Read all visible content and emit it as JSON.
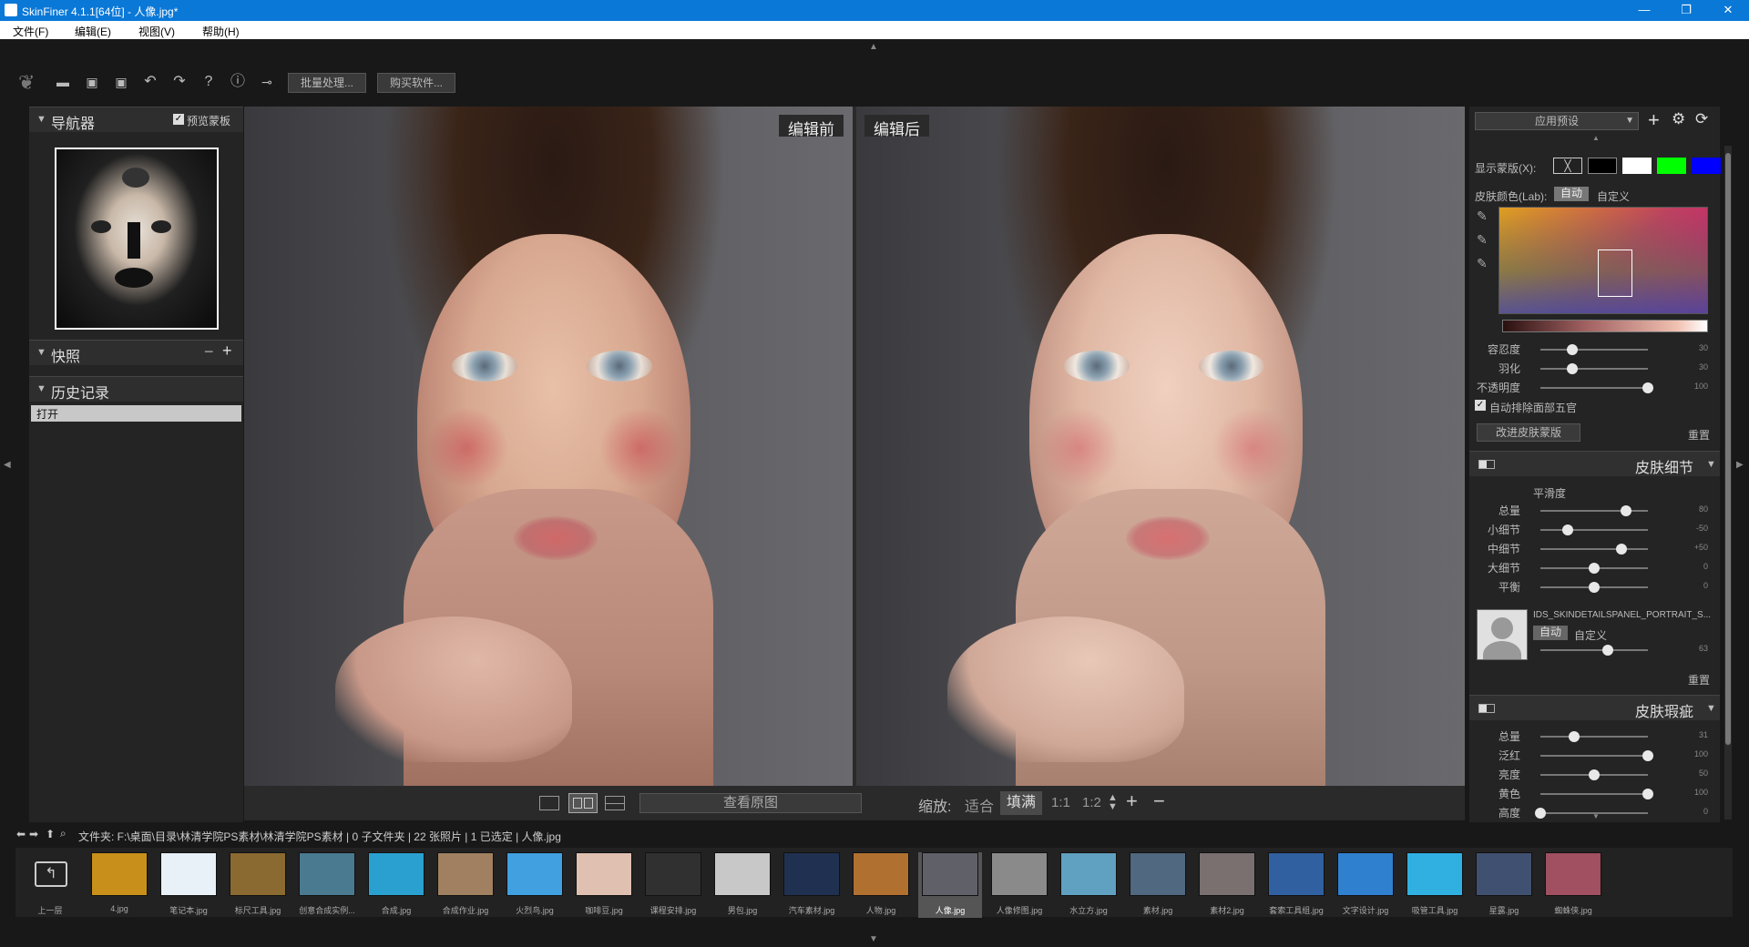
{
  "window": {
    "title": "SkinFiner 4.1.1[64位] - 人像.jpg*",
    "minimize": "—",
    "maximize": "❐",
    "close": "✕"
  },
  "menu": [
    "文件(F)",
    "编辑(E)",
    "视图(V)",
    "帮助(H)"
  ],
  "toolbar": {
    "batch_label": "批量处理...",
    "buy_label": "购买软件...",
    "help_glyph": "?",
    "info_glyph": "ⓘ"
  },
  "navigator": {
    "title": "导航器",
    "preview_mask_label": "预览蒙板",
    "preview_mask_checked": true
  },
  "snapshots": {
    "title": "快照"
  },
  "history": {
    "title": "历史记录",
    "items": [
      "打开"
    ]
  },
  "view": {
    "before_label": "编辑前",
    "after_label": "编辑后",
    "view_original_label": "查看原图",
    "zoom_label": "缩放:",
    "fit_label": "适合",
    "fill_label": "填满",
    "one_to_one": "1:1",
    "one_to_two": "1:2"
  },
  "right_panel": {
    "preset_label": "应用预设",
    "show_mask_label": "显示蒙版(X):",
    "mask_colors": [
      "#000000",
      "#ffffff",
      "#00ff00",
      "#0000ff"
    ],
    "skin_color_label": "皮肤颜色(Lab):",
    "auto_label": "自动",
    "custom_label": "自定义",
    "sliders_mask": [
      {
        "label": "容忍度",
        "value": "30",
        "pct": 0.3
      },
      {
        "label": "羽化",
        "value": "30",
        "pct": 0.3
      },
      {
        "label": "不透明度",
        "value": "100",
        "pct": 1.0
      }
    ],
    "auto_exclude_label": "自动排除面部五官",
    "improve_mask_label": "改进皮肤蒙版",
    "reset_label": "重置",
    "skin_detail": {
      "title": "皮肤细节",
      "smooth_label": "平滑度",
      "sliders": [
        {
          "label": "总量",
          "value": "80",
          "pct": 0.8
        },
        {
          "label": "小细节",
          "value": "-50",
          "pct": 0.25
        },
        {
          "label": "中细节",
          "value": "+50",
          "pct": 0.75
        },
        {
          "label": "大细节",
          "value": "0",
          "pct": 0.5
        },
        {
          "label": "平衡",
          "value": "0",
          "pct": 0.5
        }
      ],
      "preset_name": "IDS_SKINDETAILSPANEL_PORTRAIT_S...",
      "preset_value": "63",
      "preset_pct": 0.63
    },
    "skin_blemish": {
      "title": "皮肤瑕疵",
      "sliders": [
        {
          "label": "总量",
          "value": "31",
          "pct": 0.31
        },
        {
          "label": "泛红",
          "value": "100",
          "pct": 1.0
        },
        {
          "label": "亮度",
          "value": "50",
          "pct": 0.5
        },
        {
          "label": "黄色",
          "value": "100",
          "pct": 1.0
        },
        {
          "label": "高度",
          "value": "0",
          "pct": 0.0
        }
      ]
    }
  },
  "pathbar": {
    "text": "文件夹:  F:\\桌面\\目录\\林清学院PS素材\\林清学院PS素材 | 0 子文件夹 | 22 张照片 | 1 已选定 | 人像.jpg"
  },
  "filmstrip": [
    {
      "name": "上一层",
      "color": "#3a3a3a"
    },
    {
      "name": "4.jpg",
      "color": "#c8901a"
    },
    {
      "name": "笔记本.jpg",
      "color": "#e8f0f8"
    },
    {
      "name": "标尺工具.jpg",
      "color": "#8a6a30"
    },
    {
      "name": "创意合成实例...",
      "color": "#4a7a90"
    },
    {
      "name": "合成.jpg",
      "color": "#2aa0d0"
    },
    {
      "name": "合成作业.jpg",
      "color": "#a08060"
    },
    {
      "name": "火烈鸟.jpg",
      "color": "#40a0e0"
    },
    {
      "name": "咖啡豆.jpg",
      "color": "#e0c0b0"
    },
    {
      "name": "课程安排.jpg",
      "color": "#303030"
    },
    {
      "name": "男包.jpg",
      "color": "#c8c8c8"
    },
    {
      "name": "汽车素材.jpg",
      "color": "#203050"
    },
    {
      "name": "人物.jpg",
      "color": "#b07030"
    },
    {
      "name": "人像.jpg",
      "color": "#606068"
    },
    {
      "name": "人像修图.jpg",
      "color": "#8a8a8a"
    },
    {
      "name": "水立方.jpg",
      "color": "#60a0c0"
    },
    {
      "name": "素材.jpg",
      "color": "#506880"
    },
    {
      "name": "素材2.jpg",
      "color": "#7a7070"
    },
    {
      "name": "套索工具组.jpg",
      "color": "#3060a0"
    },
    {
      "name": "文字设计.jpg",
      "color": "#3080d0"
    },
    {
      "name": "吸管工具.jpg",
      "color": "#30b0e0"
    },
    {
      "name": "星露.jpg",
      "color": "#405070"
    },
    {
      "name": "蜘蛛侠.jpg",
      "color": "#a05060"
    }
  ],
  "selected_thumb": "人像.jpg"
}
